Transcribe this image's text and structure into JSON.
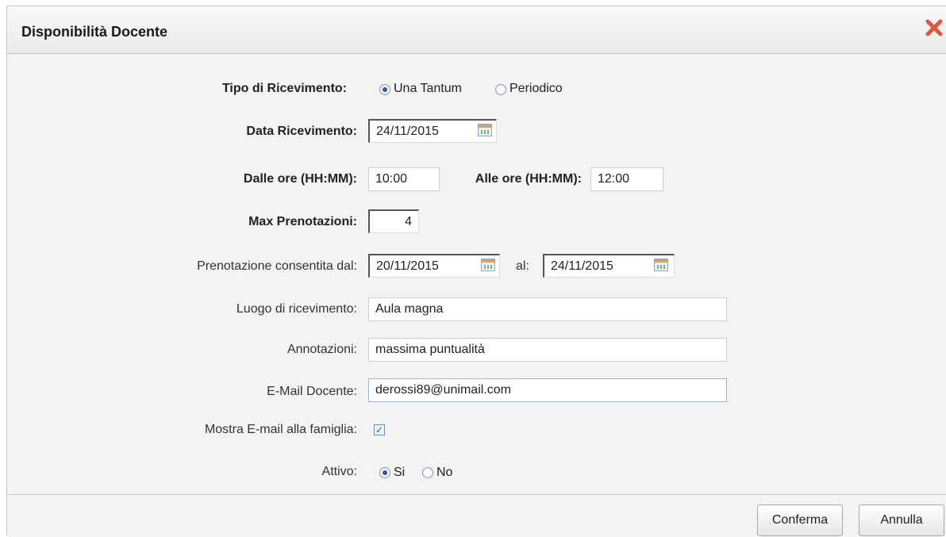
{
  "dialog": {
    "title": "Disponibilità Docente",
    "close_icon": "close-icon"
  },
  "form": {
    "tipo": {
      "label": "Tipo di Ricevimento:",
      "options": [
        "Una Tantum",
        "Periodico"
      ],
      "selected": "Una Tantum"
    },
    "data_ricevimento": {
      "label": "Data Ricevimento:",
      "value": "24/11/2015",
      "icon": "calendar-icon"
    },
    "dalle_ore": {
      "label": "Dalle ore (HH:MM):",
      "value": "10:00"
    },
    "alle_ore": {
      "label": "Alle ore (HH:MM):",
      "value": "12:00"
    },
    "max_prenotazioni": {
      "label": "Max Prenotazioni:",
      "value": "4"
    },
    "prenotazione": {
      "label": "Prenotazione consentita dal:",
      "from": "20/11/2015",
      "to_label": "al:",
      "to": "24/11/2015",
      "icon": "calendar-icon"
    },
    "luogo": {
      "label": "Luogo di ricevimento:",
      "value": "Aula magna"
    },
    "annotazioni": {
      "label": "Annotazioni:",
      "value": "massima puntualità"
    },
    "email": {
      "label": "E-Mail Docente:",
      "value": "derossi89@unimail.com"
    },
    "mostra_email": {
      "label": "Mostra E-mail alla famiglia:",
      "checked": true,
      "mark": "✓"
    },
    "attivo": {
      "label": "Attivo:",
      "options": [
        "Si",
        "No"
      ],
      "selected": "Si"
    }
  },
  "buttons": {
    "confirm": "Conferma",
    "cancel": "Annulla"
  }
}
